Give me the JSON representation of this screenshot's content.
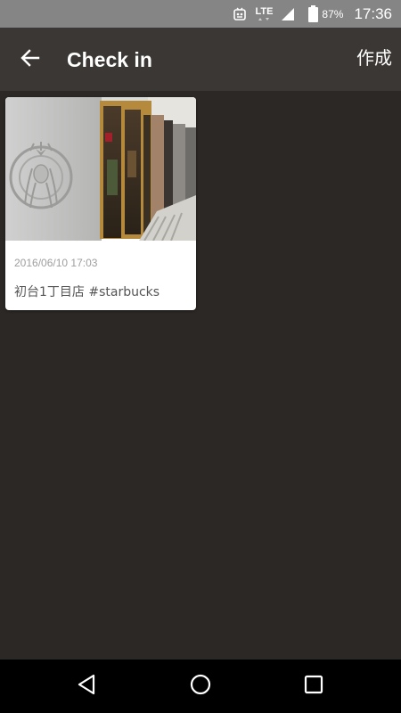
{
  "status_bar": {
    "network": "LTE",
    "battery_percent": "87%",
    "time": "17:36",
    "icons": [
      "notification-icon",
      "lte-icon",
      "signal-icon",
      "battery-icon"
    ]
  },
  "app_bar": {
    "back_icon": "arrow-back-icon",
    "title": "Check in",
    "create_label": "作成"
  },
  "checkins": [
    {
      "photo": "storefront-photo",
      "date": "2016/06/10 17:03",
      "caption": "初台1丁目店 #starbucks"
    }
  ],
  "nav_bar": {
    "icons": [
      "back-triangle-icon",
      "home-circle-icon",
      "recents-square-icon"
    ]
  },
  "colors": {
    "status_bar": "#858585",
    "app_bar": "#3b3734",
    "background": "#2c2826",
    "card": "#ffffff",
    "date_text": "#9e9e9e",
    "caption_text": "#555555"
  }
}
